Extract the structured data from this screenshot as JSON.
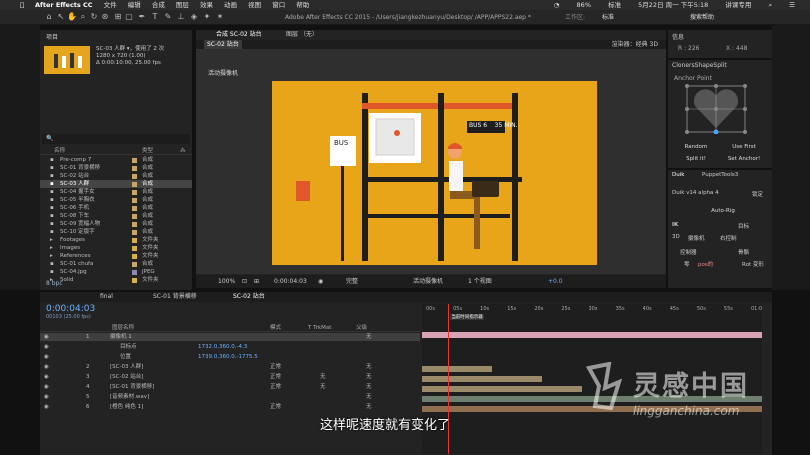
{
  "menubar": {
    "app": "After Effects CC",
    "items": [
      "文件",
      "编辑",
      "合成",
      "图层",
      "效果",
      "动画",
      "视图",
      "窗口",
      "帮助"
    ],
    "battery": "86%",
    "input": "标准",
    "datetime": "5月22日 周一 下午5:18",
    "user": "讲课专用"
  },
  "toolbar": {
    "file_path": "Adobe After Effects CC 2015 - /Users/jiangkezhuanyu/Desktop/ /APP/APPS22.aep *",
    "workspace_label": "工作区:",
    "workspace_value": "标准",
    "search_help": "搜索帮助"
  },
  "project": {
    "tab": "项目",
    "thumb_info": [
      "SC-03 人群 ▾，使用了 2 次",
      "1280 x 720 (1.00)",
      "Δ 0:00:10:00, 25.00 fps"
    ],
    "search_placeholder": "🔍",
    "col_name": "名称",
    "col_type": "类型",
    "rows": [
      {
        "name": "Pre-comp 7",
        "type": "合成",
        "color": "#c9a56a"
      },
      {
        "name": "SC-01 背景横移",
        "type": "合成",
        "color": "#c9a56a"
      },
      {
        "name": "SC-02 站台",
        "type": "合成",
        "color": "#c9a56a"
      },
      {
        "name": "SC-03 人群",
        "type": "合成",
        "color": "#c9a56a",
        "selected": true
      },
      {
        "name": "SC-04 握手女",
        "type": "合成",
        "color": "#c9a56a"
      },
      {
        "name": "SC-05 半胸衣",
        "type": "合成",
        "color": "#c9a56a"
      },
      {
        "name": "SC-06 手机",
        "type": "合成",
        "color": "#c9a56a"
      },
      {
        "name": "SC-08 下车",
        "type": "合成",
        "color": "#c9a56a"
      },
      {
        "name": "SC-09 宽幅人物",
        "type": "合成",
        "color": "#c9a56a"
      },
      {
        "name": "SC-10 定版字",
        "type": "合成",
        "color": "#c9a56a"
      },
      {
        "name": "Footages",
        "type": "文件夹",
        "color": "#d8b04a"
      },
      {
        "name": "Images",
        "type": "文件夹",
        "color": "#d8b04a"
      },
      {
        "name": "References",
        "type": "文件夹",
        "color": "#d8b04a"
      },
      {
        "name": "SC-01 chufa",
        "type": "合成",
        "color": "#c9a56a"
      },
      {
        "name": "SC-04.jpg",
        "type": "JPEG",
        "color": "#8a8ab0"
      },
      {
        "name": "Solid",
        "type": "文件夹",
        "color": "#d8b04a"
      }
    ],
    "bpc": "8 bpc"
  },
  "comp": {
    "tab": "合成 SC-02 站台",
    "layer_tab": "图层 （无）",
    "sub_label": "SC-02 站台",
    "renderer": "渲染器：经典 3D",
    "camera_label": "活动摄像机",
    "bus_sign": "BUS",
    "bus_info": "BUS 6    35 MIN.",
    "footer": {
      "zoom": "100%",
      "time": "0:00:04:03",
      "quality": "完整",
      "view": "活动摄像机",
      "views": "1 个视图",
      "offset": "+0.0"
    }
  },
  "info": {
    "tab": "信息",
    "r": "R : 226",
    "x": "X : 448"
  },
  "clonersShapeSplit": {
    "tab": "ClonersShapeSplit",
    "anchor_point": "Anchor Point",
    "random": "Random",
    "use_first": "Use First",
    "split_it": "Split it!",
    "set_anchor": "Set Anchor!"
  },
  "duik": {
    "tabs": [
      "Duik",
      "PuppetTools3"
    ],
    "version": "Duik v14 alpha 4",
    "lock": "锁定",
    "auto_rig": "Auto-Rig",
    "ik": "IK",
    "target": "目标",
    "three_d": "3D",
    "cam_rig": "摄像机",
    "right_hand": "右控制",
    "controller": "控制器",
    "bone": "骨骼",
    "zero": "零",
    "pos": "pos的",
    "rot": "Rot 变形"
  },
  "timeline": {
    "tabs": [
      "final",
      "SC-01 背景横移",
      "SC-02 站台"
    ],
    "timecode": "0:00:04:03",
    "fps": "00103 (25.00 fps)",
    "col_name": "图层名称",
    "col_mode": "模式",
    "col_trk": "T TrkMat",
    "col_parent": "父级",
    "layers": [
      {
        "num": "1",
        "name": "摄像机 1",
        "parent": "无",
        "selected": true
      },
      {
        "num": "",
        "name": "目标点",
        "value": "1732.0,360.0,-4.3"
      },
      {
        "num": "",
        "name": "位置",
        "value": "1739.0,360.0,-1775.5"
      },
      {
        "num": "2",
        "name": "[SC-03 人群]",
        "mode": "正常",
        "trk": "",
        "parent": "无"
      },
      {
        "num": "3",
        "name": "[SC-02 站台]",
        "mode": "正常",
        "trk": "无",
        "parent": "无"
      },
      {
        "num": "4",
        "name": "[SC-01 背景横移]",
        "mode": "正常",
        "trk": "无",
        "parent": "无"
      },
      {
        "num": "5",
        "name": "[音频素材.wav]",
        "mode": "",
        "trk": "",
        "parent": "无"
      },
      {
        "num": "6",
        "name": "[橙色 纯色 1]",
        "mode": "正常",
        "trk": "",
        "parent": "无"
      }
    ],
    "ruler": [
      "00s",
      "05s",
      "10s",
      "15s",
      "20s",
      "25s",
      "30s",
      "35s",
      "40s",
      "45s",
      "50s",
      "55s",
      "01:0"
    ],
    "cti_tooltip": "当前时间指示器",
    "playhead_seconds": 4.12,
    "duration_seconds": 60
  },
  "subtitle": "这样呢速度就有变化了",
  "watermark": {
    "cn": "灵感中国",
    "en": "lingganchina.com"
  }
}
